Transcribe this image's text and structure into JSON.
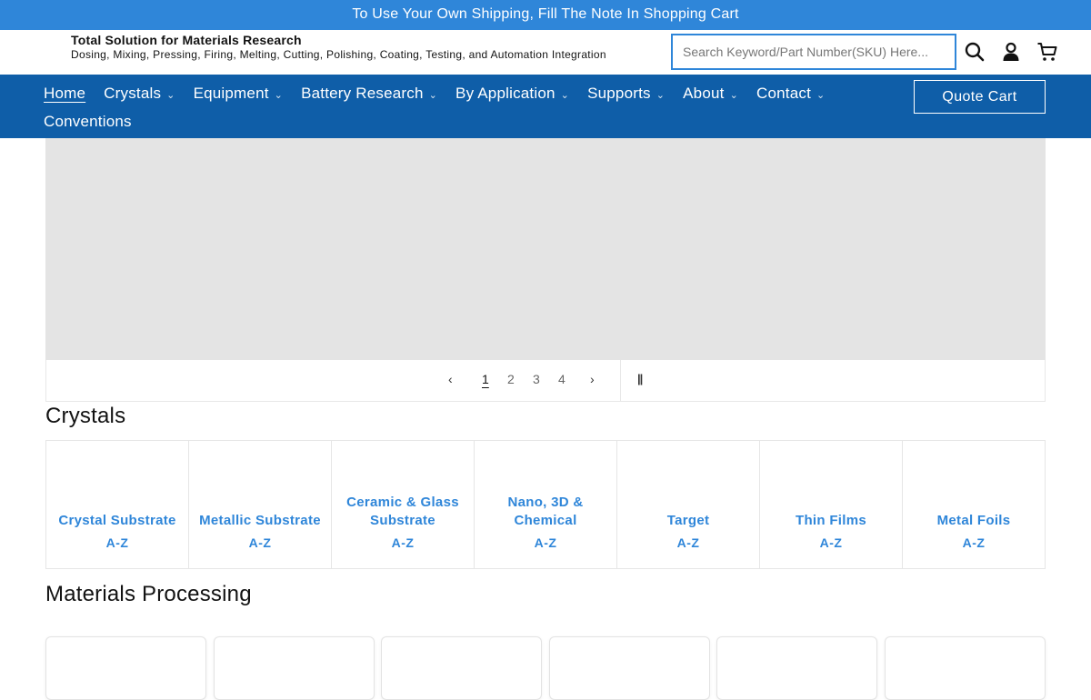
{
  "announcement": "To Use Your Own Shipping, Fill The Note In Shopping Cart",
  "brand": {
    "title": "Total Solution for Materials Research",
    "subtitle": "Dosing, Mixing, Pressing, Firing, Melting, Cutting, Polishing, Coating, Testing, and Automation Integration"
  },
  "search": {
    "placeholder": "Search Keyword/Part Number(SKU) Here...",
    "value": ""
  },
  "header_icons": [
    "search-icon",
    "account-icon",
    "cart-icon"
  ],
  "nav": {
    "items": [
      {
        "label": "Home",
        "has_dropdown": false,
        "active": true
      },
      {
        "label": "Crystals",
        "has_dropdown": true
      },
      {
        "label": "Equipment",
        "has_dropdown": true
      },
      {
        "label": "Battery Research",
        "has_dropdown": true
      },
      {
        "label": "By Application",
        "has_dropdown": true
      },
      {
        "label": "Supports",
        "has_dropdown": true
      },
      {
        "label": "About",
        "has_dropdown": true
      },
      {
        "label": "Contact",
        "has_dropdown": true
      }
    ],
    "row2": "Conventions",
    "quote_cart": "Quote Cart"
  },
  "slider": {
    "pages": [
      "1",
      "2",
      "3",
      "4"
    ],
    "current": 1
  },
  "crystals": {
    "title": "Crystals",
    "items": [
      {
        "name": "Crystal Substrate",
        "az": "A-Z"
      },
      {
        "name": "Metallic Substrate",
        "az": "A-Z"
      },
      {
        "name": "Ceramic & Glass Substrate",
        "az": "A-Z"
      },
      {
        "name": "Nano, 3D & Chemical",
        "az": "A-Z"
      },
      {
        "name": "Target",
        "az": "A-Z"
      },
      {
        "name": "Thin Films",
        "az": "A-Z"
      },
      {
        "name": "Metal Foils",
        "az": "A-Z"
      }
    ]
  },
  "processing": {
    "title": "Materials Processing"
  },
  "colors": {
    "accent": "#2f86d9",
    "nav_bg": "#0f5ea8",
    "slide_bg": "#e4e4e4"
  }
}
